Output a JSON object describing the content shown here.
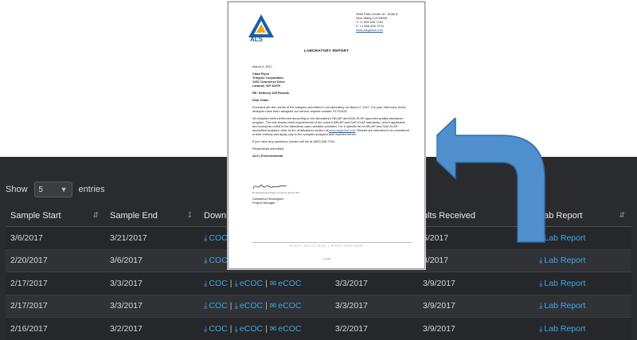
{
  "length_menu": {
    "show_label": "Show",
    "selected": "5",
    "entries_label": "entries"
  },
  "table": {
    "columns": [
      "Sample Start",
      "Sample End",
      "Downl",
      "",
      "ults Received",
      "Lab Report"
    ],
    "rows": [
      {
        "sample_start": "3/6/2017",
        "sample_end": "3/21/2017",
        "coc": "COC",
        "ecoc1": "",
        "ecoc2": "",
        "col4": "",
        "results_received": "5/2017",
        "lab_report": "Lab Report"
      },
      {
        "sample_start": "2/20/2017",
        "sample_end": "3/6/2017",
        "coc": "COC",
        "ecoc1": "",
        "ecoc2": "",
        "col4": "",
        "results_received": "3/2017",
        "lab_report": "Lab Report"
      },
      {
        "sample_start": "2/17/2017",
        "sample_end": "3/3/2017",
        "coc": "COC",
        "ecoc1": "eCOC",
        "ecoc2": "eCOC",
        "col4": "3/3/2017",
        "results_received": "3/9/2017",
        "lab_report": "Lab Report"
      },
      {
        "sample_start": "2/17/2017",
        "sample_end": "3/3/2017",
        "coc": "COC",
        "ecoc1": "eCOC",
        "ecoc2": "eCOC",
        "col4": "3/3/2017",
        "results_received": "3/9/2017",
        "lab_report": "Lab Report"
      },
      {
        "sample_start": "2/16/2017",
        "sample_end": "3/2/2017",
        "coc": "COC",
        "ecoc1": "eCOC",
        "ecoc2": "eCOC",
        "col4": "3/2/2017",
        "results_received": "3/9/2017",
        "lab_report": "Lab Report"
      }
    ]
  },
  "document": {
    "logo": "ALS",
    "address": [
      "2655 Park Center Dr., Suite A",
      "Simi Valley, CA 93065",
      "T: +1 805 526 7161",
      "F: +1 805 526 7270",
      "www.alsglobal.com"
    ],
    "title": "LABORATORY REPORT",
    "date": "March 9, 2017",
    "recipient": [
      "Chad Flynn",
      "Trihydro Corporation",
      "1252 Commerce Drive",
      "Laramie, WY 82070"
    ],
    "re": "RE: Refinery 325 Results",
    "salutation": "Dear Chad:",
    "para1": "Enclosed are the results of the samples submitted to our laboratory on March 2, 2017. For your reference, these analyses have been assigned our service request number P1701025.",
    "para2a": "All analyses were performed according to our laboratory's NELAP and DoD-ELAP-approved quality assurance program. The test results meet requirements of the current NELAP and DoD-ELAP standards, where applicable, and except as noted in the laboratory case narrative provided. For a specific list of NELAP and DoD-ELAP-accredited analytes, refer to the certifications section at ",
    "para2_link": "www.alsglobal.com",
    "para2b": ". Results are intended to be considered in their entirety and apply only to the samples analyzed and reported herein.",
    "para3": "If you have any questions, please call me at (805) 526-7161.",
    "closing": "Respectfully submitted,",
    "company": "ALS | Environmental",
    "signature_caption": "By Samantha Henningsen at 2:40 pm, Mar 09, 2017",
    "signer_name": "Samantha Henningsen",
    "signer_title": "Project Manager",
    "footer": "RIGHT SOLUTIONS | RIGHT PARTNER",
    "page_number": "1 of 16"
  },
  "colors": {
    "panel_bg": "#2a2b2e",
    "link": "#3ca8e8",
    "arrow": "#4f8fce"
  }
}
